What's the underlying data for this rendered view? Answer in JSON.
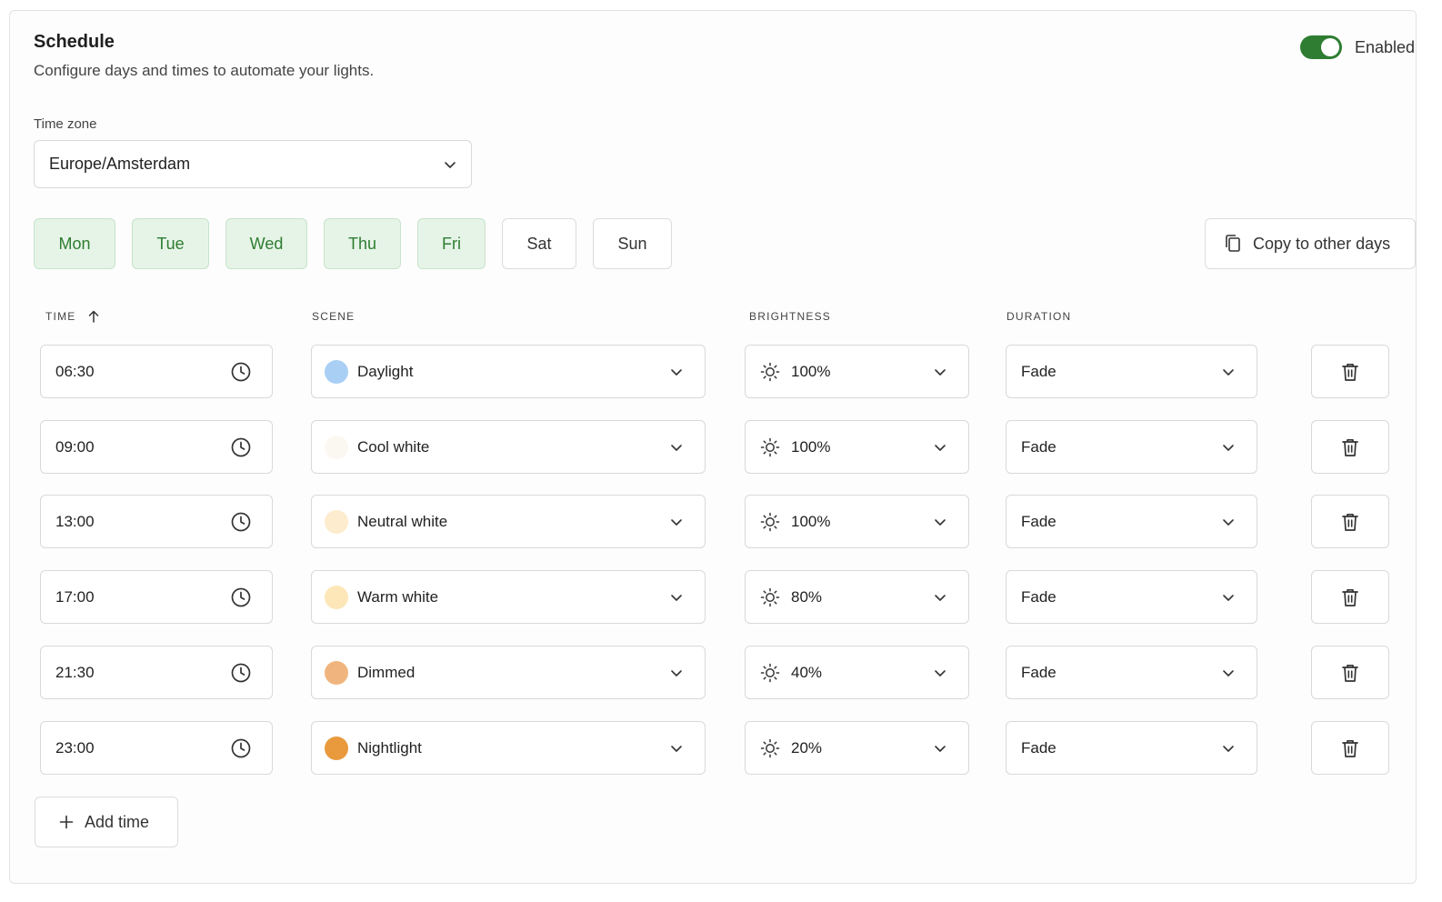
{
  "header": {
    "title": "Schedule",
    "subtitle": "Configure days and times to automate your lights.",
    "toggle_label": "Enabled",
    "toggle_on": true,
    "accent_color": "#2e7d32"
  },
  "timezone": {
    "label": "Time zone",
    "value": "Europe/Amsterdam"
  },
  "days": [
    {
      "label": "Mon",
      "active": true
    },
    {
      "label": "Tue",
      "active": true
    },
    {
      "label": "Wed",
      "active": true
    },
    {
      "label": "Thu",
      "active": true
    },
    {
      "label": "Fri",
      "active": true
    },
    {
      "label": "Sat",
      "active": false
    },
    {
      "label": "Sun",
      "active": false
    }
  ],
  "copy_button_label": "Copy to other days",
  "columns": {
    "time": "TIME",
    "scene": "SCENE",
    "brightness": "BRIGHTNESS",
    "duration": "DURATION"
  },
  "rows": [
    {
      "time": "06:30",
      "scene": "Daylight",
      "scene_color": "#a9cff4",
      "brightness": "100%",
      "duration": "Fade"
    },
    {
      "time": "09:00",
      "scene": "Cool white",
      "scene_color": "#fbf8f2",
      "brightness": "100%",
      "duration": "Fade"
    },
    {
      "time": "13:00",
      "scene": "Neutral white",
      "scene_color": "#fdeccd",
      "brightness": "100%",
      "duration": "Fade"
    },
    {
      "time": "17:00",
      "scene": "Warm white",
      "scene_color": "#fde6b8",
      "brightness": "80%",
      "duration": "Fade"
    },
    {
      "time": "21:30",
      "scene": "Dimmed",
      "scene_color": "#f0b57e",
      "brightness": "40%",
      "duration": "Fade"
    },
    {
      "time": "23:00",
      "scene": "Nightlight",
      "scene_color": "#e89a3c",
      "brightness": "20%",
      "duration": "Fade"
    }
  ],
  "add_button_label": "Add time"
}
